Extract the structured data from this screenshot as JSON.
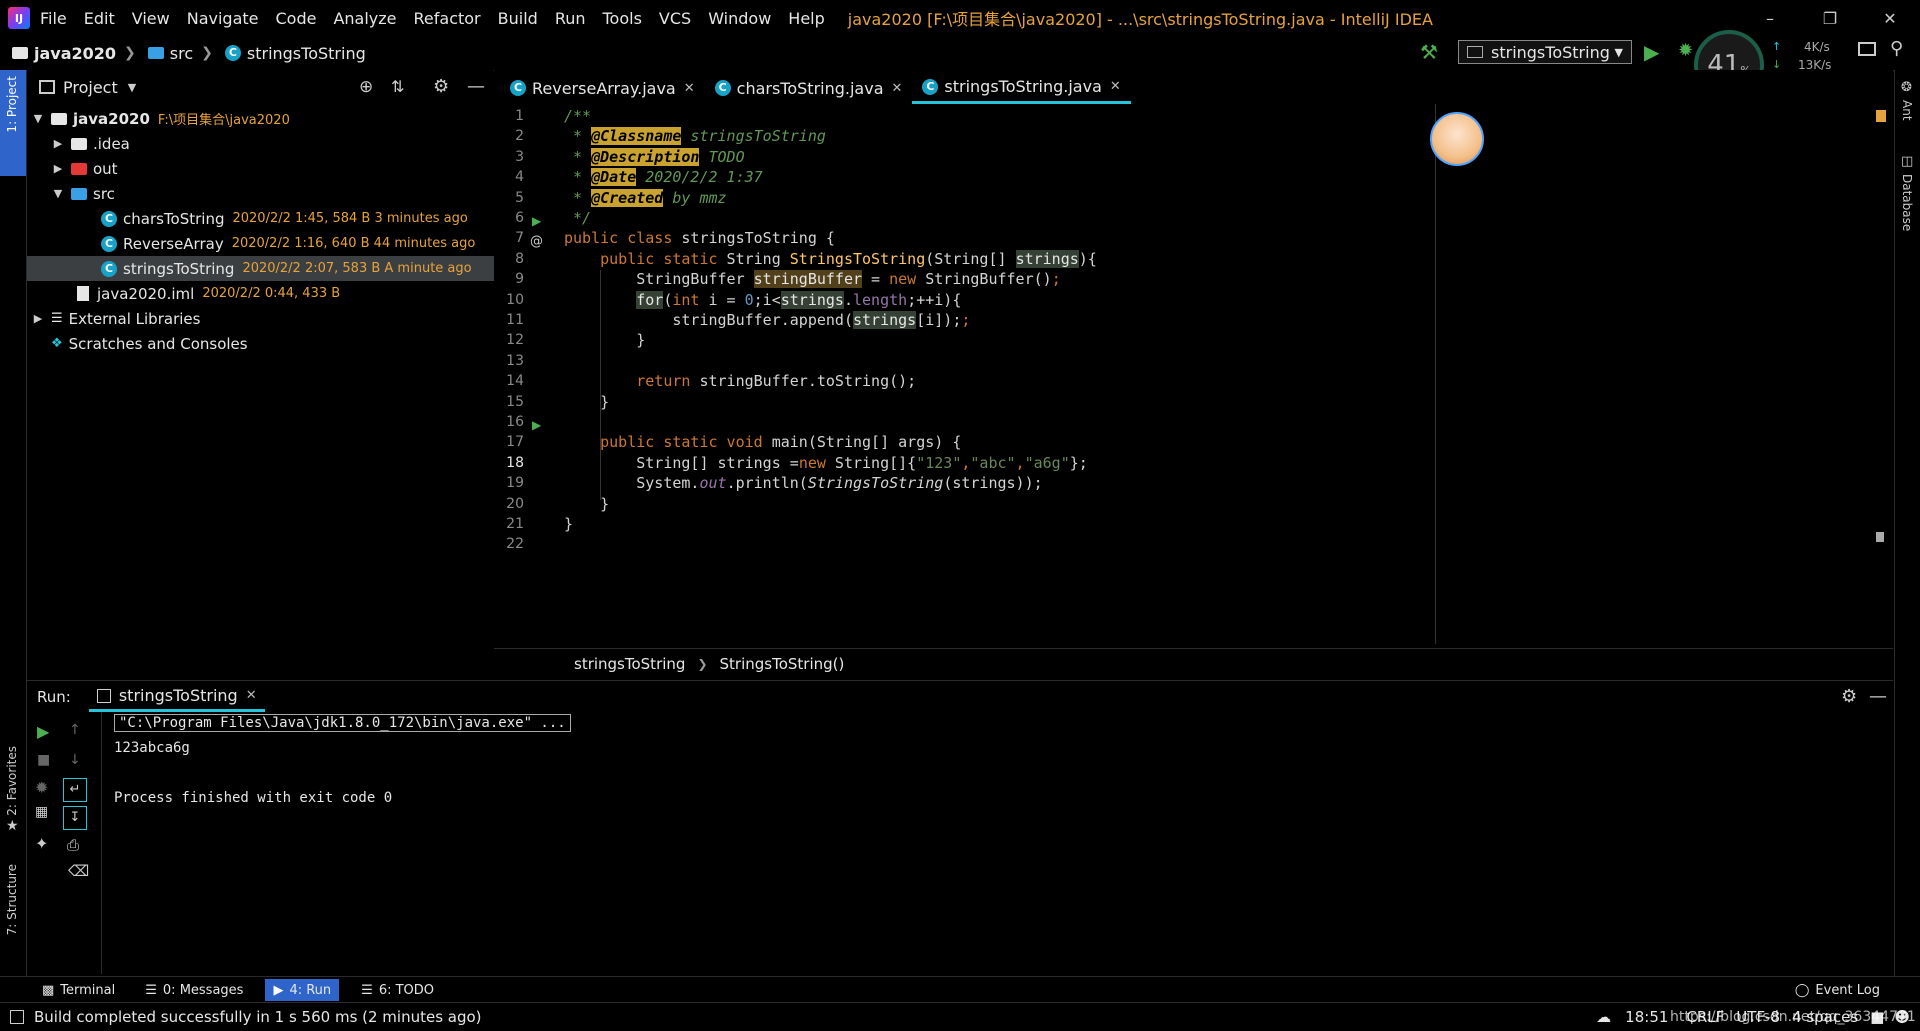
{
  "window": {
    "menu": [
      "File",
      "Edit",
      "View",
      "Navigate",
      "Code",
      "Analyze",
      "Refactor",
      "Build",
      "Run",
      "Tools",
      "VCS",
      "Window",
      "Help"
    ],
    "title": "java2020 [F:\\项目集合\\java2020] - ...\\src\\stringsToString.java - IntelliJ IDEA"
  },
  "navbar": {
    "crumbs": [
      "java2020",
      "src",
      "stringsToString"
    ],
    "run_config": "stringsToString",
    "cpu_percent": "41",
    "cpu_unit": "%",
    "net_up": "4K/s",
    "net_down": "13K/s"
  },
  "left_stripe": {
    "project": "1: Project",
    "favorites": "2: Favorites",
    "structure": "7: Structure"
  },
  "right_stripe": {
    "ant": "Ant",
    "database": "Database"
  },
  "project": {
    "header": "Project",
    "tree": [
      {
        "name": "java2020",
        "meta": "F:\\项目集合\\java2020",
        "icon": "folder-icon"
      },
      {
        "name": ".idea",
        "meta": "",
        "icon": "folder-icon"
      },
      {
        "name": "out",
        "meta": "",
        "icon": "folder-icon"
      },
      {
        "name": "src",
        "meta": "",
        "icon": "folder-icon"
      },
      {
        "name": "charsToString",
        "meta": "2020/2/2 1:45, 584 B 3 minutes ago",
        "icon": "class-icon"
      },
      {
        "name": "ReverseArray",
        "meta": "2020/2/2 1:16, 640 B 44 minutes ago",
        "icon": "class-icon"
      },
      {
        "name": "stringsToString",
        "meta": "2020/2/2 2:07, 583 B A minute ago",
        "icon": "class-icon"
      },
      {
        "name": "java2020.iml",
        "meta": "2020/2/2 0:44, 433 B",
        "icon": "file-icon"
      },
      {
        "name": "External Libraries",
        "meta": "",
        "icon": "library-icon"
      },
      {
        "name": "Scratches and Consoles",
        "meta": "",
        "icon": "scratch-icon"
      }
    ]
  },
  "editor": {
    "tabs": [
      {
        "label": "ReverseArray.java",
        "active": false
      },
      {
        "label": "charsToString.java",
        "active": false
      },
      {
        "label": "stringsToString.java",
        "active": true
      }
    ],
    "line_numbers": [
      "1",
      "2",
      "3",
      "4",
      "5",
      "6",
      "7",
      "8",
      "9",
      "10",
      "11",
      "12",
      "13",
      "14",
      "15",
      "16",
      "17",
      "18",
      "19",
      "20",
      "21",
      "22"
    ],
    "current_line": "18",
    "breadcrumb": [
      "stringsToString",
      "StringsToString()"
    ],
    "code": {
      "l1": "/**",
      "l2_tag": "@Classname",
      "l2_val": " stringsToString",
      "l3_tag": "@Description",
      "l3_val": " TODO",
      "l4_tag": "@Date",
      "l4_val": " 2020/2/2 1:37",
      "l5_tag": "@Created",
      "l5_val": " by mmz",
      "l6": " */",
      "l7a": "public class",
      "l7b": " stringsToString {",
      "l8a": "    public static",
      "l8b": " String ",
      "l8c": "StringsToString",
      "l8d": "(String[] ",
      "l8e": "strings",
      "l8f": "){",
      "l9a": "        StringBuffer ",
      "l9b": "stringBuffer",
      "l9c": " = ",
      "l9d": "new",
      "l9e": " StringBuffer()",
      "l10a": "for",
      "l10b": "(",
      "l10c": "int",
      "l10d": " i = ",
      "l10e": "0",
      "l10f": ";i<",
      "l10g": "strings",
      ".length": ".length",
      "l10h": ".",
      "l10i": "length",
      "l10j": ";++i){",
      "l11a": "            stringBuffer.append(",
      "l11b": "strings",
      "l11c": "[i]);",
      "l12": "        }",
      "l14a": "        return",
      "l14b": " stringBuffer.toString();",
      "l15": "    }",
      "l17a": "    public static void",
      "l17b": " main(String[] args) {",
      "l18a": "        String[] strings =",
      "l18b": "new",
      "l18c": " String[]{",
      "l18d": "\"123\"",
      "l18e": ",",
      "l18f": "\"abc\"",
      "l18g": ",",
      "l18h": "\"a6g\"",
      "l18i": "};",
      "l19a": "        System.",
      "l19b": "out",
      "l19c": ".println(",
      "l19d": "StringsToString",
      "l19e": "(strings));",
      "l20": "    }",
      "l21": "}"
    }
  },
  "run": {
    "label": "Run:",
    "tab": "stringsToString",
    "console": [
      "\"C:\\Program Files\\Java\\jdk1.8.0_172\\bin\\java.exe\" ...",
      "123abca6g",
      "",
      "Process finished with exit code 0"
    ]
  },
  "bottom_tabs": [
    "Terminal",
    "0: Messages",
    "4: Run",
    "6: TODO"
  ],
  "event_log": "Event Log",
  "status": {
    "message": "Build completed successfully in 1 s 560 ms (2 minutes ago)",
    "time": "18:51",
    "line_sep": "CRLF",
    "encoding": "UTF-8",
    "indent": "4 spaces",
    "watermark": "https://blog.csdn.net/qq_36344771"
  },
  "colors": {
    "accent": "#26c6da",
    "current_line": "#0d0d73",
    "comment": "#629755",
    "keyword": "#cc7832",
    "string": "#6a8759",
    "meta": "#e6a23c"
  }
}
